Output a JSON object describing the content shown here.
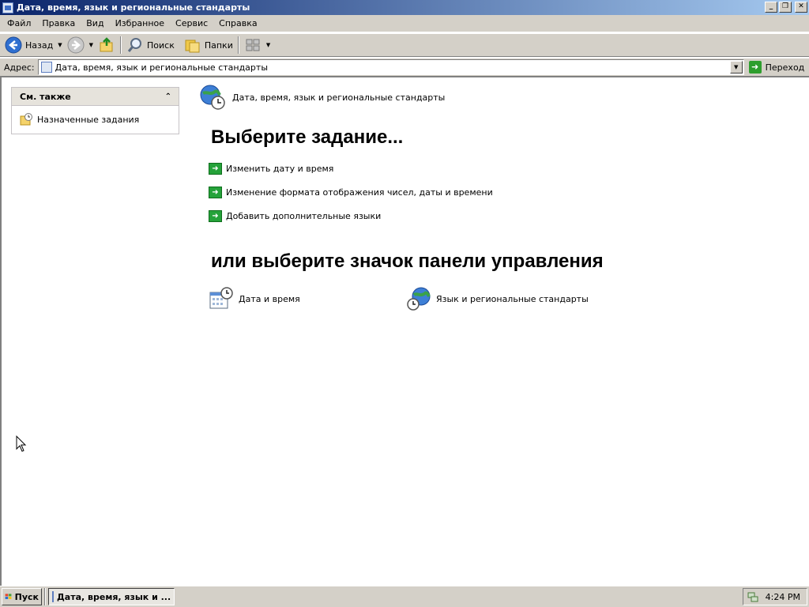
{
  "window": {
    "title": "Дата, время, язык и региональные стандарты"
  },
  "title_buttons": {
    "minimize": "_",
    "maximize": "❐",
    "close": "✕"
  },
  "menu": [
    "Файл",
    "Правка",
    "Вид",
    "Избранное",
    "Сервис",
    "Справка"
  ],
  "toolbar": {
    "back_label": "Назад",
    "search_label": "Поиск",
    "folders_label": "Папки"
  },
  "address": {
    "label": "Адрес:",
    "value": "Дата, время, язык и региональные стандарты",
    "go_label": "Переход"
  },
  "sidebar": {
    "section_title": "См. также",
    "items": [
      {
        "label": "Назначенные задания"
      }
    ]
  },
  "main": {
    "category_title": "Дата, время, язык и региональные стандарты",
    "pick_task_heading": "Выберите задание...",
    "tasks": [
      {
        "label": "Изменить дату и время"
      },
      {
        "label": "Изменение формата отображения чисел, даты и времени"
      },
      {
        "label": "Добавить дополнительные языки"
      }
    ],
    "pick_icon_heading": "или выберите значок панели управления",
    "control_panel_icons": [
      {
        "label": "Дата и время",
        "icon": "calendar-clock-icon"
      },
      {
        "label": "Язык и региональные стандарты",
        "icon": "globe-clock-icon"
      }
    ]
  },
  "taskbar": {
    "start_label": "Пуск",
    "window_button_label": "Дата, время, язык и ...",
    "clock": "4:24 PM"
  },
  "colors": {
    "titlebar_start": "#0a246a",
    "titlebar_end": "#a6caf0",
    "task_arrow": "#25a23a",
    "chrome": "#d4d0c8"
  }
}
